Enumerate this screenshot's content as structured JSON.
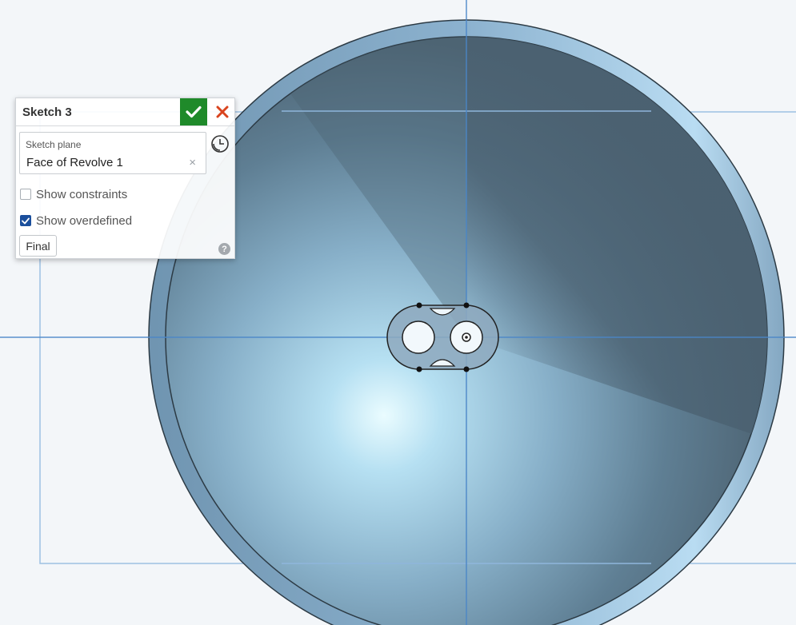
{
  "dialog": {
    "title": "Sketch 3",
    "sketch_plane_label": "Sketch plane",
    "sketch_plane_value": "Face of Revolve 1",
    "show_constraints_label": "Show constraints",
    "show_constraints_checked": false,
    "show_overdefined_label": "Show overdefined",
    "show_overdefined_checked": true,
    "final_label": "Final",
    "help_label": "?",
    "ok_icon": "checkmark-icon",
    "cancel_icon": "close-icon",
    "clear_icon": "×"
  },
  "viewport": {
    "background_color": "#f3f6f9",
    "axis_color": "#4a86c8",
    "body_rim_color": "#7ba3c4",
    "face_light_color": "#eafcff",
    "face_dark_color": "#4f6676",
    "accent_ok_color": "#1f8a2a",
    "accent_cancel_color": "#d9441e"
  }
}
